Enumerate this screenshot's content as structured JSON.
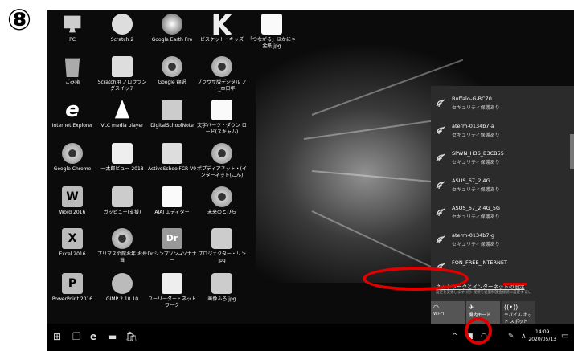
{
  "step_marker": "⑧",
  "desktop_icons": [
    {
      "label": "PC",
      "icon": "pc"
    },
    {
      "label": "Scratch 2",
      "icon": "cat"
    },
    {
      "label": "Google Earth Pro",
      "icon": "globe"
    },
    {
      "label": "ビスケット・キッズ",
      "icon": "k"
    },
    {
      "label": "「つながる」ほかにゃ 金紙.jpg",
      "icon": "doc"
    },
    {
      "label": "ごみ箱",
      "icon": "trash"
    },
    {
      "label": "Scratch用 ノロウラン グスイッチ",
      "icon": "book"
    },
    {
      "label": "Google 翻訳",
      "icon": "chrome"
    },
    {
      "label": "ブラウザ版デジタル ノート_本日年",
      "icon": "chrome"
    },
    {
      "label": "Internet Explorer",
      "icon": "ie"
    },
    {
      "label": "VLC media player",
      "icon": "cone"
    },
    {
      "label": "DigitalSchoolNote",
      "icon": "d"
    },
    {
      "label": "文字パーツ・ダウン ロード(スキャム)",
      "icon": "doc"
    },
    {
      "label": "Google Chrome",
      "icon": "chrome"
    },
    {
      "label": "一太郎ビュー 2018",
      "icon": "map"
    },
    {
      "label": "ActiveSchoolFCR V9",
      "icon": "book"
    },
    {
      "label": "ポプディアネット・(イ ンターネット(こん)",
      "icon": "chrome"
    },
    {
      "label": "Word 2016",
      "icon": "word"
    },
    {
      "label": "ガッピュー(支援)",
      "icon": "camera"
    },
    {
      "label": "AIAI エディター",
      "icon": "doc"
    },
    {
      "label": "未来のとびら",
      "icon": "chrome"
    },
    {
      "label": "Excel 2016",
      "icon": "excel"
    },
    {
      "label": "プリマスの館お年 お弁当",
      "icon": "chrome"
    },
    {
      "label": "Dr.シンプソン→ソナナー",
      "icon": "dr"
    },
    {
      "label": "プロジェクター・リン jpg",
      "icon": "camera"
    },
    {
      "label": "PowerPoint 2016",
      "icon": "ppt"
    },
    {
      "label": "GIMP 2.10.10",
      "icon": "gimp"
    },
    {
      "label": "ユーリーダー・ネット ワーク",
      "icon": "map"
    },
    {
      "label": "画像ふろ.jpg",
      "icon": "camera"
    }
  ],
  "wifi_networks": [
    {
      "ssid": "Buffalo-G-BC70",
      "security": "セキュリティ保護あり"
    },
    {
      "ssid": "aterm-0134b7-a",
      "security": "セキュリティ保護あり"
    },
    {
      "ssid": "SPWN_H36_B3CB55",
      "security": "セキュリティ保護あり"
    },
    {
      "ssid": "ASUS_67_2.4G",
      "security": "セキュリティ保護あり"
    },
    {
      "ssid": "ASUS_67_2.4G_5G",
      "security": "セキュリティ保護あり"
    },
    {
      "ssid": "aterm-0134b7-g",
      "security": "セキュリティ保護あり"
    },
    {
      "ssid": "FON_FREE_INTERNET",
      "security": ""
    }
  ],
  "network_settings": {
    "link": "ネットワークとインターネットの設定",
    "sub": "設定を変更します (例: 接続を従量制課金接続に設定する)。"
  },
  "quick_tiles": [
    {
      "label": "Wi-Fi",
      "icon": "wifi-icon"
    },
    {
      "label": "機内モード",
      "icon": "airplane-icon"
    },
    {
      "label": "モバイル ホット スポット",
      "icon": "hotspot-icon"
    }
  ],
  "clock": {
    "time": "14:09",
    "date": "2020/05/13"
  }
}
